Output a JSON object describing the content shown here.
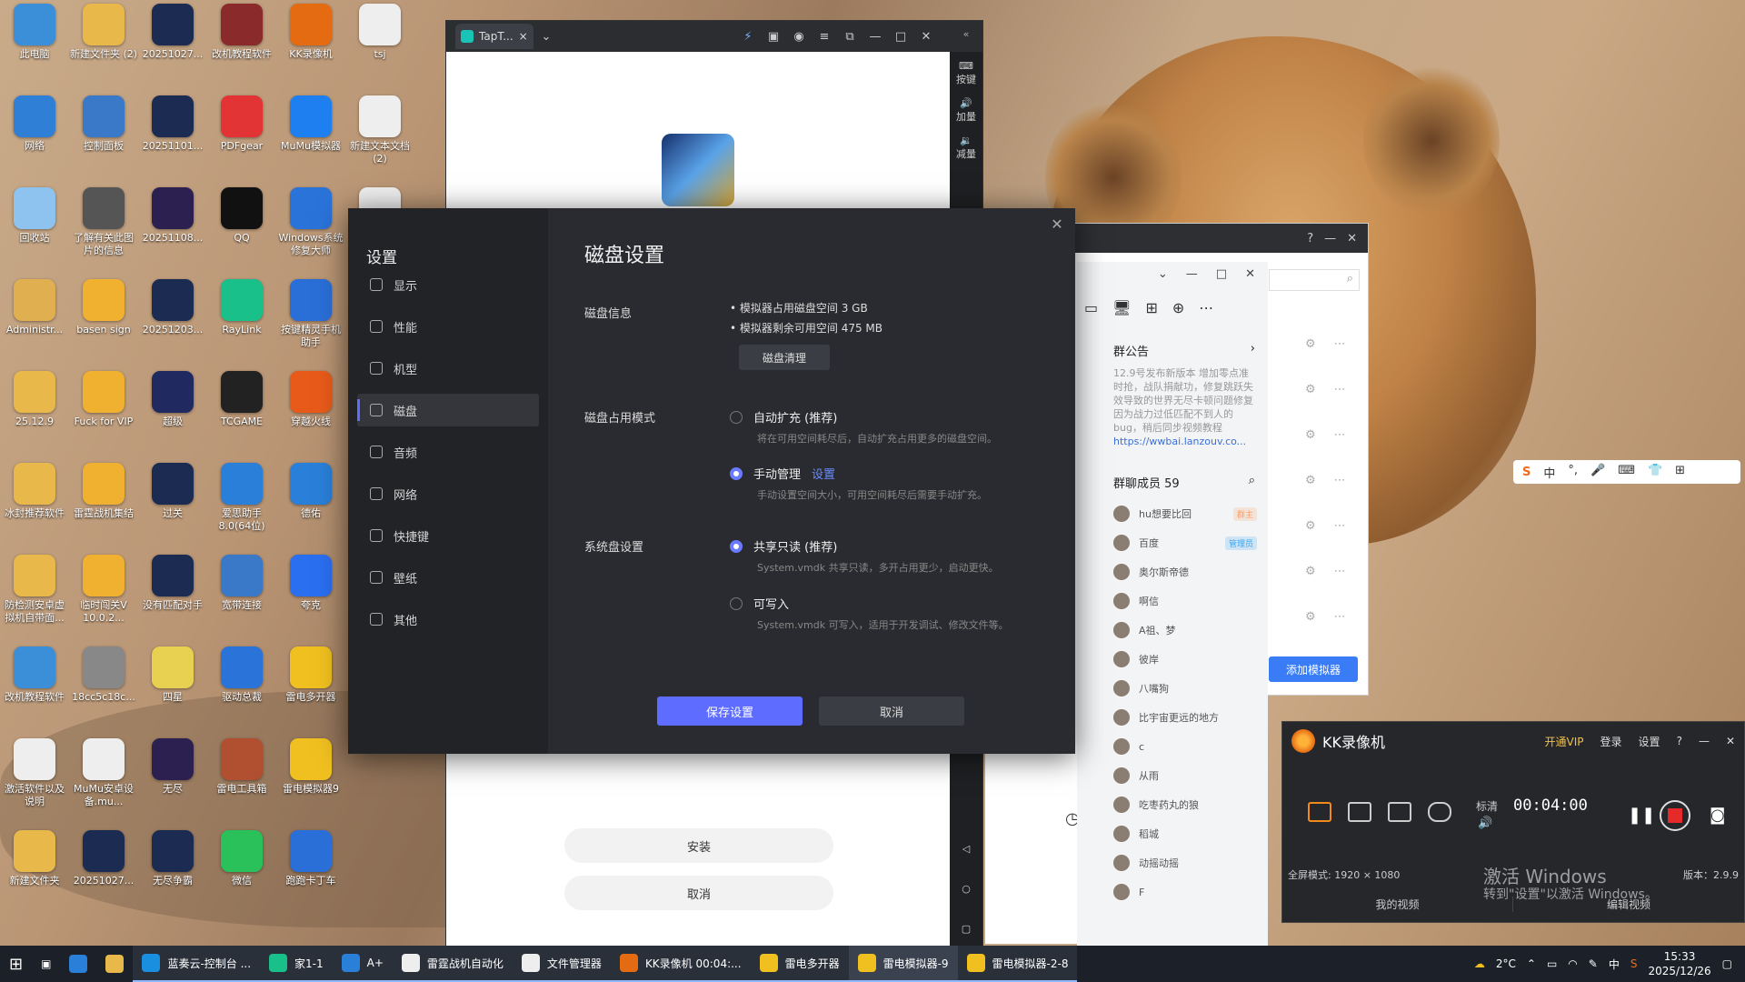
{
  "desktop_icons": [
    {
      "label": "此电脑",
      "color": "#3b8fd8"
    },
    {
      "label": "新建文件夹 (2)",
      "color": "#e8b84a"
    },
    {
      "label": "20251027...",
      "color": "#1b2b52"
    },
    {
      "label": "改机教程软件",
      "color": "#8a2a2a"
    },
    {
      "label": "KK录像机",
      "color": "#e56b12"
    },
    {
      "label": "tsj",
      "color": "#eeeeee"
    },
    {
      "label": "网络",
      "color": "#2f7fd6"
    },
    {
      "label": "控制面板",
      "color": "#3a78c8"
    },
    {
      "label": "20251101...",
      "color": "#1b2b52"
    },
    {
      "label": "PDFgear",
      "color": "#e23434"
    },
    {
      "label": "MuMu模拟器",
      "color": "#1e7ff0"
    },
    {
      "label": "新建文本文档 (2)",
      "color": "#eeeeee"
    },
    {
      "label": "回收站",
      "color": "#8ec3f0"
    },
    {
      "label": "了解有关此图片的信息",
      "color": "#555555"
    },
    {
      "label": "20251108...",
      "color": "#2b2050"
    },
    {
      "label": "QQ",
      "color": "#111111"
    },
    {
      "label": "Windows系统修复大师",
      "color": "#2a73d9"
    },
    {
      "label": "",
      "color": "#eeeeee"
    },
    {
      "label": "Administr...",
      "color": "#e0b050"
    },
    {
      "label": "basen sign",
      "color": "#f0b030"
    },
    {
      "label": "20251203...",
      "color": "#1b2b52"
    },
    {
      "label": "RayLink",
      "color": "#19c08a"
    },
    {
      "label": "按键精灵手机助手",
      "color": "#2a6fd8"
    },
    {
      "label": "25.12.9",
      "color": "#e8b84a"
    },
    {
      "label": "Fuck for VIP",
      "color": "#f0b030"
    },
    {
      "label": "超级",
      "color": "#202a60"
    },
    {
      "label": "TCGAME",
      "color": "#222222"
    },
    {
      "label": "穿越火线",
      "color": "#e85a1a"
    },
    {
      "label": "冰封推荐软件",
      "color": "#e8b84a"
    },
    {
      "label": "雷霆战机集结",
      "color": "#f0b030"
    },
    {
      "label": "过关",
      "color": "#1b2b52"
    },
    {
      "label": "爱思助手8.0(64位)",
      "color": "#2a7fd8"
    },
    {
      "label": "德佑",
      "color": "#2a7fd8"
    },
    {
      "label": "防检测安卓虚拟机自带面...",
      "color": "#e8b84a"
    },
    {
      "label": "临时闯关V 10.0.2...",
      "color": "#f0b030"
    },
    {
      "label": "没有匹配对手",
      "color": "#1b2b52"
    },
    {
      "label": "宽带连接",
      "color": "#3a78c8"
    },
    {
      "label": "夸克",
      "color": "#2a6ff0"
    },
    {
      "label": "改机教程软件",
      "color": "#3a8fd8"
    },
    {
      "label": "18cc5c18c...",
      "color": "#888888"
    },
    {
      "label": "四星",
      "color": "#e8d050"
    },
    {
      "label": "驱动总裁",
      "color": "#2a73d9"
    },
    {
      "label": "雷电多开器",
      "color": "#f0c020"
    },
    {
      "label": "激活软件以及说明",
      "color": "#eeeeee"
    },
    {
      "label": "MuMu安卓设备.mu...",
      "color": "#eeeeee"
    },
    {
      "label": "无尽",
      "color": "#2b2050"
    },
    {
      "label": "雷电工具箱",
      "color": "#b05030"
    },
    {
      "label": "雷电模拟器9",
      "color": "#f0c020"
    },
    {
      "label": "新建文件夹",
      "color": "#e8b84a"
    },
    {
      "label": "20251027...",
      "color": "#1b2b52"
    },
    {
      "label": "无尽争霸",
      "color": "#1b2b52"
    },
    {
      "label": "微信",
      "color": "#2ac05a"
    },
    {
      "label": "跑跑卡丁车",
      "color": "#2a6fd8"
    }
  ],
  "taptap": {
    "tab": "TapT...",
    "side": [
      "按键",
      "加量",
      "减量"
    ],
    "install": "安装",
    "cancel": "取消"
  },
  "settings": {
    "title": "设置",
    "nav": [
      {
        "label": "显示"
      },
      {
        "label": "性能"
      },
      {
        "label": "机型"
      },
      {
        "label": "磁盘",
        "active": true
      },
      {
        "label": "音频"
      },
      {
        "label": "网络"
      },
      {
        "label": "快捷键"
      },
      {
        "label": "壁纸"
      },
      {
        "label": "其他"
      }
    ],
    "heading": "磁盘设置",
    "disk_info_label": "磁盘信息",
    "disk_used": "• 模拟器占用磁盘空间 3 GB",
    "disk_free": "• 模拟器剩余可用空间 475 MB",
    "clean_btn": "磁盘清理",
    "mode_label": "磁盘占用模式",
    "auto": "自动扩充 (推荐)",
    "auto_desc": "将在可用空间耗尽后，自动扩充占用更多的磁盘空间。",
    "manual": "手动管理",
    "manual_link": "设置",
    "manual_desc": "手动设置空间大小，可用空间耗尽后需要手动扩充。",
    "sys_label": "系统盘设置",
    "shared": "共享只读 (推荐)",
    "shared_desc": "System.vmdk 共享只读，多开占用更少，启动更快。",
    "writable": "可写入",
    "writable_desc": "System.vmdk 可写入，适用于开发调试、修改文件等。",
    "save": "保存设置",
    "cancel": "取消"
  },
  "qq": {
    "announce_title": "群公告",
    "announce": "12.9号发布新版本 增加零点准时抢，战队捐献功，修复跳跃失效导致的世界无尽卡顿问题修复因为战力过低匹配不到人的bug，稍后同步视频教程",
    "announce_link": "https://wwbai.lanzouv.co...",
    "members_title": "群聊成员 59",
    "members": [
      {
        "name": "hu想要比回",
        "tag": "群主",
        "tag_color": "#f5a06a"
      },
      {
        "name": "百度",
        "tag": "管理员",
        "tag_color": "#3aa6f0"
      },
      {
        "name": "奥尔斯帝德"
      },
      {
        "name": "啊信"
      },
      {
        "name": "A祖、梦"
      },
      {
        "name": "彼岸"
      },
      {
        "name": "八嘴狗"
      },
      {
        "name": "比宇宙更远的地方"
      },
      {
        "name": "c"
      },
      {
        "name": "从雨"
      },
      {
        "name": "吃枣药丸的狼"
      },
      {
        "name": "稻城"
      },
      {
        "name": "动摇动摇"
      },
      {
        "name": "F"
      }
    ],
    "add_emulator": "添加模拟器"
  },
  "kk": {
    "title": "KK录像机",
    "vip": "开通VIP",
    "login": "登录",
    "settings": "设置",
    "quality": "标清",
    "time": "00:04:00",
    "mode": "全屏模式:  1920 × 1080",
    "version": "版本：2.9.9",
    "my_videos": "我的视频",
    "edit_video": "编辑视频"
  },
  "watermark": {
    "line1": "激活 Windows",
    "line2": "转到\"设置\"以激活 Windows。"
  },
  "ime": {
    "items": [
      "中",
      "°,",
      "🎤",
      "⌨",
      "👕",
      "⊞"
    ]
  },
  "taskbar": {
    "apps": [
      {
        "label": "蓝奏云-控制台 ...",
        "color": "#1a8fe0"
      },
      {
        "label": "家1-1",
        "color": "#19c08a"
      },
      {
        "label": "A+",
        "color": "#2a7fd8"
      },
      {
        "label": "雷霆战机自动化",
        "color": "#eeeeee"
      },
      {
        "label": "文件管理器",
        "color": "#eeeeee"
      },
      {
        "label": "KK录像机 00:04:...",
        "color": "#e56b12"
      },
      {
        "label": "雷电多开器",
        "color": "#f0c020"
      },
      {
        "label": "雷电模拟器-9",
        "color": "#f0c020",
        "active": true
      },
      {
        "label": "雷电模拟器-2-8",
        "color": "#f0c020"
      }
    ],
    "weather": "2°C",
    "ime": "中",
    "time": "15:33",
    "date": "2025/12/26"
  }
}
